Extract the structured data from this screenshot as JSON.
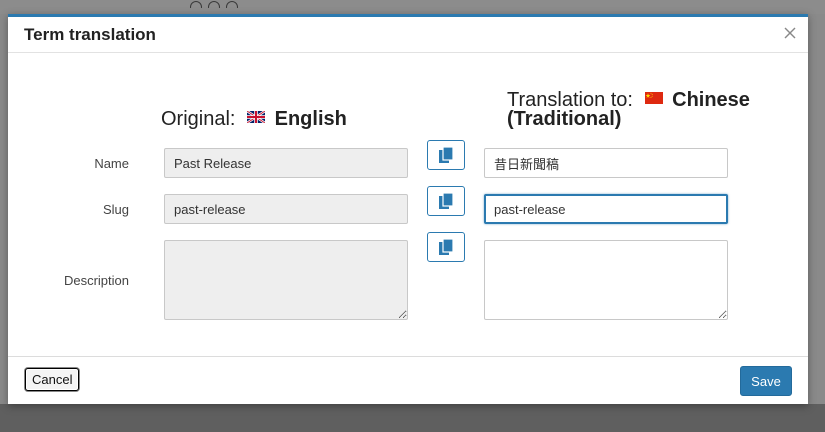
{
  "dialog": {
    "title": "Term translation"
  },
  "original": {
    "heading_prefix": "Original:",
    "language": "English",
    "flag_icon": "uk-flag-icon"
  },
  "translation": {
    "heading_prefix": "Translation to:",
    "language": "Chinese (Traditional)",
    "flag_icon": "china-flag-icon"
  },
  "rows": {
    "name_label": "Name",
    "slug_label": "Slug",
    "description_label": "Description"
  },
  "fields": {
    "original_name": "Past Release",
    "original_slug": "past-release",
    "original_description": "",
    "translated_name": "昔日新聞稿",
    "translated_slug": "past-release",
    "translated_description": ""
  },
  "footer": {
    "cancel_label": "Cancel",
    "save_label": "Save"
  },
  "colors": {
    "accent": "#2b7ab0",
    "readonly_bg": "#eeeeee"
  }
}
